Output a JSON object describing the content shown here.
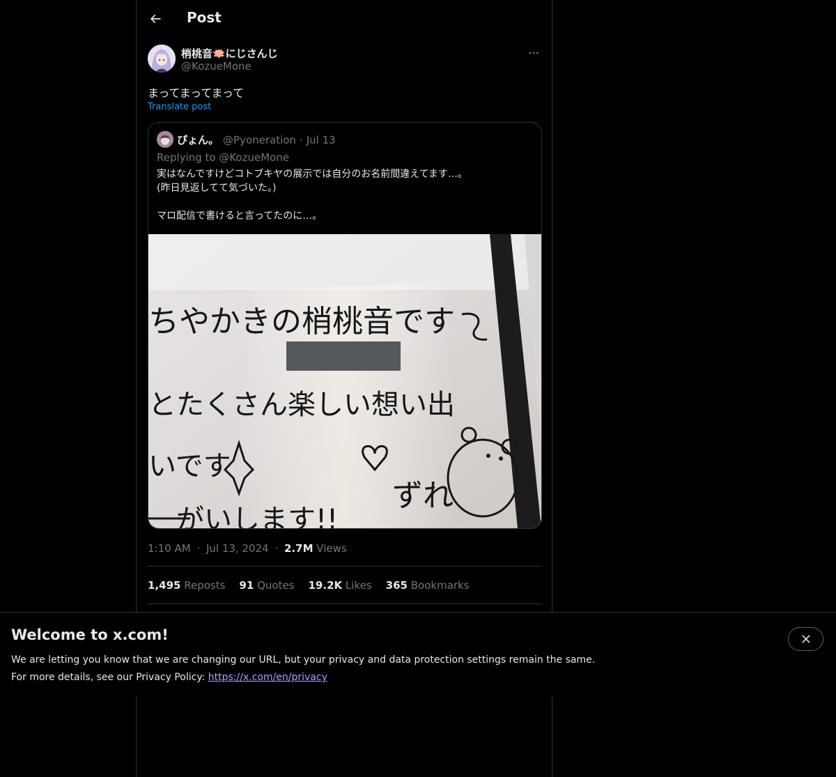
{
  "header": {
    "title": "Post"
  },
  "post": {
    "author_name": "梢桃音🪷にじさんじ",
    "author_handle": "@KozueMone",
    "text": "まってまってまって",
    "translate_label": "Translate post",
    "time": "1:10 AM",
    "date": "Jul 13, 2024",
    "views_count": "2.7M",
    "views_label": "Views",
    "separator": "·"
  },
  "quote": {
    "name": "ぴょん。",
    "handle": "@Pyoneration",
    "date": "Jul 13",
    "separator": "·",
    "replying_to": "Replying to @KozueMone",
    "lines": [
      "実はなんですけどコトブキヤの展示では自分のお名前間違えてます…。",
      "(昨日見返してて気づいた。)",
      "",
      "マロ配信で書けると言ってたのに…。"
    ],
    "image_alt": "Handwritten whiteboard message",
    "image_text": [
      "ちやかきの梢桃音です",
      "とたくさん楽しい想い出",
      "いです",
      "がいします!!",
      "ずれ"
    ]
  },
  "stats": {
    "reposts_count": "1,495",
    "reposts_label": "Reposts",
    "quotes_count": "91",
    "quotes_label": "Quotes",
    "likes_count": "19.2K",
    "likes_label": "Likes",
    "bookmarks_count": "365",
    "bookmarks_label": "Bookmarks"
  },
  "banner": {
    "title": "Welcome to x.com!",
    "line1": "We are letting you know that we are changing our URL, but your privacy and data protection settings remain the same.",
    "line2_prefix": "For more details, see our Privacy Policy: ",
    "link": "https://x.com/en/privacy"
  },
  "colors": {
    "background": "#000000",
    "text": "#e7e9ea",
    "secondary": "#71767b",
    "link": "#1d9bf0",
    "border": "#2f3336"
  },
  "icons": {
    "back": "arrow-left-icon",
    "more": "more-horizontal-icon",
    "close": "close-icon"
  }
}
